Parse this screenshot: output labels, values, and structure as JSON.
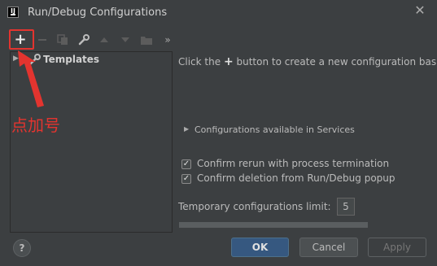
{
  "window": {
    "title": "Run/Debug Configurations",
    "close_icon": "close-icon"
  },
  "toolbar": {
    "items": [
      "add-icon",
      "remove-icon",
      "copy-icon",
      "wrench-icon",
      "move-up-icon",
      "move-down-icon",
      "folder-icon",
      "more-icon"
    ],
    "plus_symbol": "+",
    "more_symbol": "»"
  },
  "tree": {
    "templates_label": "Templates"
  },
  "annotation": {
    "text": "点加号",
    "color": "#e3342f"
  },
  "right_panel": {
    "hint_prefix": "Click the",
    "hint_plus": "+",
    "hint_suffix": "button to create a new configuration bas",
    "services_label": "Configurations available in Services",
    "confirm_rerun": {
      "label": "Confirm rerun with process termination",
      "checked": true
    },
    "confirm_deletion": {
      "label": "Confirm deletion from Run/Debug popup",
      "checked": true
    },
    "temp_limit_label": "Temporary configurations limit:",
    "temp_limit_value": "5"
  },
  "buttons": {
    "help": "?",
    "ok": "OK",
    "cancel": "Cancel",
    "apply": "Apply"
  },
  "colors": {
    "background": "#3c3f41",
    "accent": "#365880",
    "annotation": "#e3342f"
  }
}
